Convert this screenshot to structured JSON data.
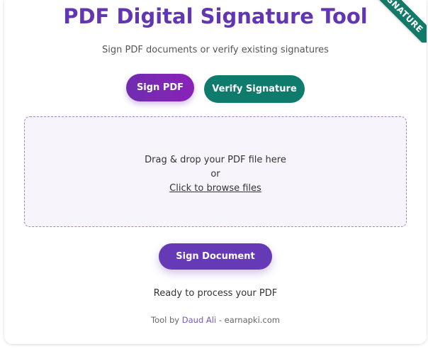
{
  "ribbon": {
    "text": "SIGNATURE"
  },
  "header": {
    "title": "PDF Digital Signature Tool",
    "subtitle": "Sign PDF documents or verify existing signatures"
  },
  "mode_buttons": {
    "sign_label": "Sign PDF",
    "verify_label": "Verify Signature"
  },
  "dropzone": {
    "line1": "Drag & drop your PDF file here",
    "line2": "or",
    "browse_label": "Click to browse files"
  },
  "actions": {
    "sign_document_label": "Sign Document"
  },
  "status": {
    "text": "Ready to process your PDF"
  },
  "footer": {
    "prefix": "Tool by ",
    "author": "Daud Ali",
    "separator": " - ",
    "site": "earnapki.com"
  },
  "colors": {
    "title": "#6236b3",
    "sign_button": "#7a2bb5",
    "verify_button": "#0e7b6c",
    "sign_document_button": "#6639b7",
    "ribbon": "#137a6a"
  }
}
